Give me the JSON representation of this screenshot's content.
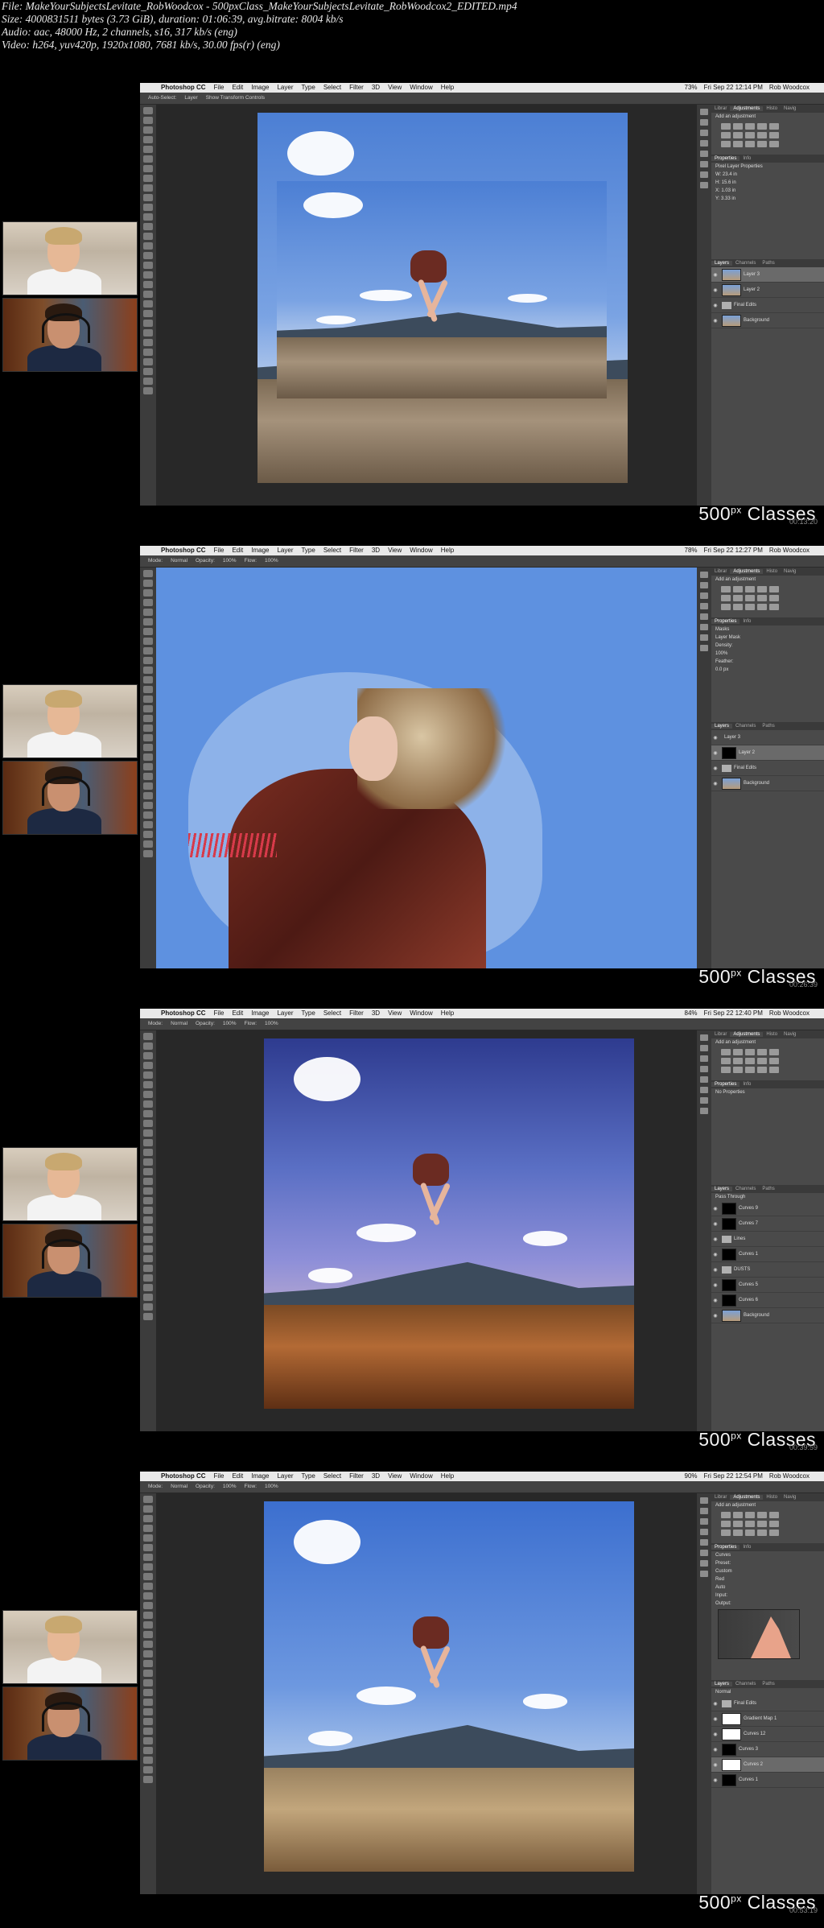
{
  "file_info": {
    "line1": "File: MakeYourSubjectsLevitate_RobWoodcox - 500pxClass_MakeYourSubjectsLevitate_RobWoodcox2_EDITED.mp4",
    "line2": "Size: 4000831511 bytes (3.73 GiB), duration: 01:06:39, avg.bitrate: 8004 kb/s",
    "line3": "Audio: aac, 48000 Hz, 2 channels, s16, 317 kb/s (eng)",
    "line4": "Video: h264, yuv420p, 1920x1080, 7681 kb/s, 30.00 fps(r) (eng)"
  },
  "watermark": "500px Classes",
  "watermark_main": "500",
  "watermark_sup": "px",
  "watermark_tail": " Classes",
  "menu": {
    "apple": "",
    "app": "Photoshop CC",
    "items": [
      "File",
      "Edit",
      "Image",
      "Layer",
      "Type",
      "Select",
      "Filter",
      "3D",
      "View",
      "Window",
      "Help"
    ],
    "user": "Rob Woodcox"
  },
  "frames": [
    {
      "battery": "73%",
      "clock": "Fri Sep 22 12:14 PM",
      "timecode": "00:13:20",
      "options": [
        "Auto-Select:",
        "Layer",
        "Show Transform Controls"
      ],
      "adj_tabs": [
        "Librar",
        "Adjustments",
        "Histo",
        "Navig"
      ],
      "adj_title": "Add an adjustment",
      "props_tabs": [
        "Properties",
        "Info"
      ],
      "props_title": "Pixel Layer Properties",
      "props_fields": [
        "W: 23.4 in",
        "H: 15.6 in",
        "X: 1.03 in",
        "Y: 3.33 in"
      ],
      "layers_tabs": [
        "Layers",
        "Channels",
        "Paths"
      ],
      "layers": [
        {
          "name": "Layer 3",
          "type": "photo",
          "selected": true
        },
        {
          "name": "Layer 2",
          "type": "photo",
          "selected": false
        },
        {
          "name": "Final Edits",
          "type": "folder",
          "selected": false
        },
        {
          "name": "Background",
          "type": "photo",
          "selected": false
        }
      ]
    },
    {
      "battery": "78%",
      "clock": "Fri Sep 22 12:27 PM",
      "timecode": "00:26:39",
      "options": [
        "Mode:",
        "Normal",
        "Opacity:",
        "100%",
        "Flow:",
        "100%"
      ],
      "adj_tabs": [
        "Librar",
        "Adjustments",
        "Histo",
        "Navig"
      ],
      "adj_title": "Add an adjustment",
      "props_tabs": [
        "Properties",
        "Info"
      ],
      "props_title": "Masks",
      "props_fields": [
        "Layer Mask",
        "Density:",
        "100%",
        "Feather:",
        "0.0 px"
      ],
      "layers_tabs": [
        "Layers",
        "Channels",
        "Paths"
      ],
      "layers": [
        {
          "name": "Layer 3",
          "type": "blank",
          "selected": false
        },
        {
          "name": "Layer 2",
          "type": "mask",
          "selected": true
        },
        {
          "name": "Final Edits",
          "type": "folder",
          "selected": false
        },
        {
          "name": "Background",
          "type": "photo",
          "selected": false
        }
      ]
    },
    {
      "battery": "84%",
      "clock": "Fri Sep 22 12:40 PM",
      "timecode": "00:39:59",
      "options": [
        "Mode:",
        "Normal",
        "Opacity:",
        "100%",
        "Flow:",
        "100%"
      ],
      "adj_tabs": [
        "Librar",
        "Adjustments",
        "Histo",
        "Navig"
      ],
      "adj_title": "Add an adjustment",
      "props_tabs": [
        "Properties",
        "Info"
      ],
      "props_title": "No Properties",
      "props_fields": [],
      "layers_tabs": [
        "Layers",
        "Channels",
        "Paths"
      ],
      "blend": "Pass Through",
      "layers": [
        {
          "name": "Curves 9",
          "type": "mask",
          "selected": false
        },
        {
          "name": "Curves 7",
          "type": "mask",
          "selected": false
        },
        {
          "name": "Lines",
          "type": "folder",
          "selected": false
        },
        {
          "name": "Curves 1",
          "type": "mask",
          "selected": false
        },
        {
          "name": "DUSTS",
          "type": "folder",
          "selected": false
        },
        {
          "name": "Curves 5",
          "type": "mask",
          "selected": false
        },
        {
          "name": "Curves 6",
          "type": "mask",
          "selected": false
        },
        {
          "name": "Background",
          "type": "photo",
          "selected": false
        }
      ]
    },
    {
      "battery": "90%",
      "clock": "Fri Sep 22 12:54 PM",
      "timecode": "00:53:19",
      "options": [
        "Mode:",
        "Normal",
        "Opacity:",
        "100%",
        "Flow:",
        "100%"
      ],
      "adj_tabs": [
        "Librar",
        "Adjustments",
        "Histo",
        "Navig"
      ],
      "adj_title": "Add an adjustment",
      "props_tabs": [
        "Properties",
        "Info"
      ],
      "props_title": "Curves",
      "props_fields": [
        "Preset:",
        "Custom",
        "Red",
        "Auto",
        "Input:",
        "Output:"
      ],
      "layers_tabs": [
        "Layers",
        "Channels",
        "Paths"
      ],
      "blend": "Normal",
      "layers": [
        {
          "name": "Final Edits",
          "type": "folder",
          "selected": false
        },
        {
          "name": "Gradient Map 1",
          "type": "white",
          "selected": false
        },
        {
          "name": "Curves 12",
          "type": "white",
          "selected": false
        },
        {
          "name": "Curves 3",
          "type": "mask",
          "selected": false
        },
        {
          "name": "Curves 2",
          "type": "white",
          "selected": true
        },
        {
          "name": "Curves 1",
          "type": "mask",
          "selected": false
        }
      ]
    }
  ]
}
